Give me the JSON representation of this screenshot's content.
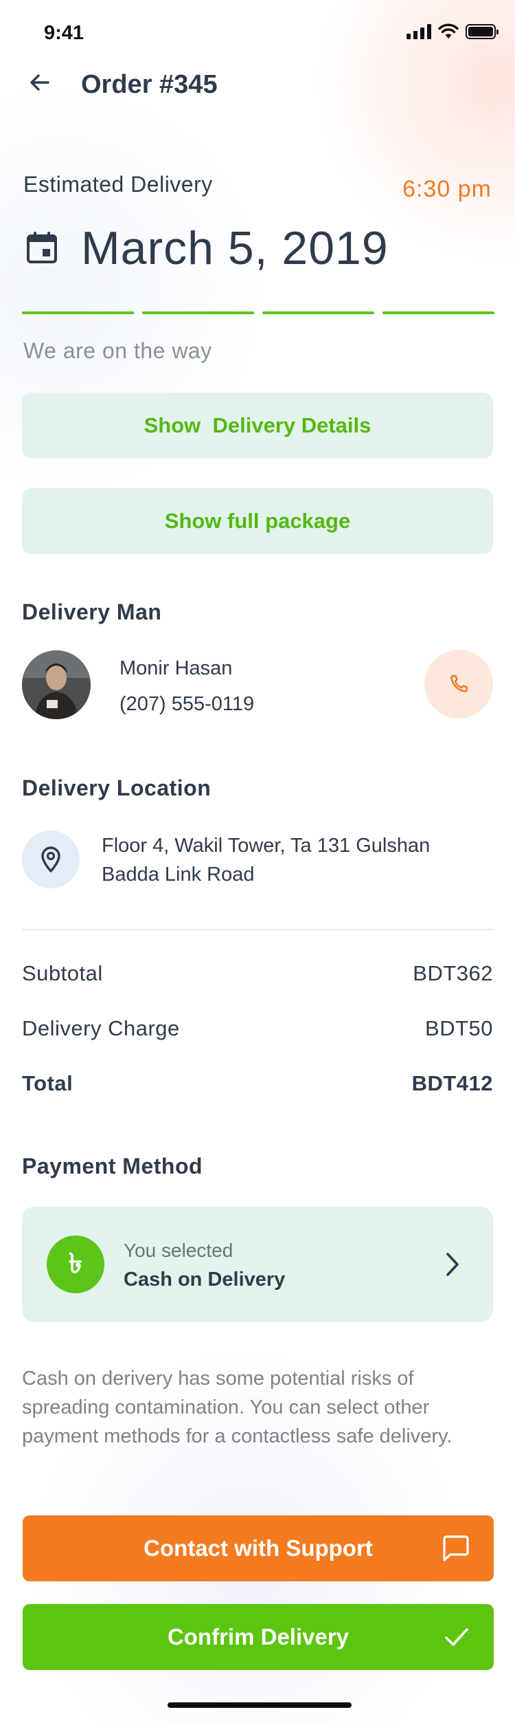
{
  "status_bar": {
    "time": "9:41",
    "signal_icon": "cellular-signal-icon",
    "wifi_icon": "wifi-icon",
    "battery_icon": "battery-icon"
  },
  "header": {
    "title": "Order #345",
    "back_icon": "arrow-left-icon"
  },
  "delivery": {
    "estimated_label": "Estimated Delivery",
    "time": "6:30 pm",
    "date": "March 5, 2019",
    "status": "We are on the way",
    "progress_steps_completed": 4,
    "progress_steps_total": 4,
    "show_details_label": "Show  Delivery Details",
    "show_package_label": "Show full package"
  },
  "delivery_man": {
    "section_title": "Delivery Man",
    "name": "Monir Hasan",
    "phone": "(207) 555-0119",
    "call_icon": "phone-icon"
  },
  "delivery_location": {
    "section_title": "Delivery Location",
    "line1": "Floor 4, Wakil Tower, Ta 131 Gulshan",
    "line2": "Badda Link Road",
    "pin_icon": "location-pin-icon"
  },
  "summary": {
    "subtotal_label": "Subtotal",
    "subtotal_value": "BDT362",
    "delivery_label": "Delivery Charge",
    "delivery_value": "BDT50",
    "total_label": "Total",
    "total_value": "BDT412"
  },
  "payment": {
    "section_title": "Payment Method",
    "badge_symbol": "৳",
    "selected_label": "You selected",
    "method": "Cash on Delivery",
    "note": "Cash on derivery has some potential risks of spreading contamination. You can select other payment methods for a contactless safe delivery."
  },
  "actions": {
    "support_label": "Contact with Support",
    "confirm_label": "Confrim Delivery"
  },
  "colors": {
    "accent_green": "#5cc51a",
    "accent_orange": "#f07b23",
    "soft_green": "#e1f3ea",
    "text_dark": "#2f3b4c"
  }
}
